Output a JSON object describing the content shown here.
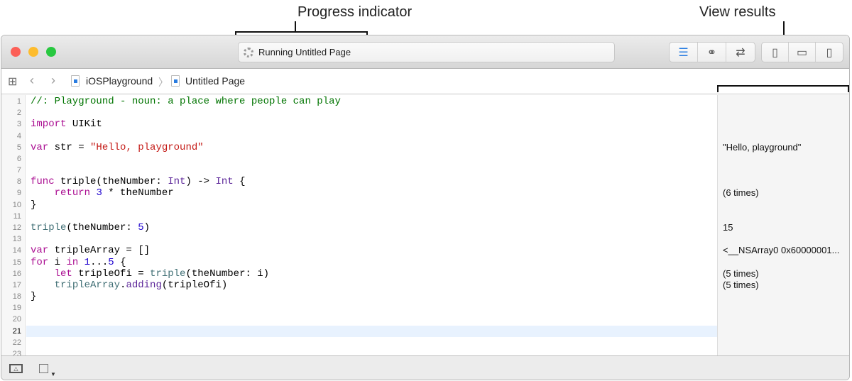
{
  "annotations": {
    "progress": "Progress indicator",
    "view_results": "View results"
  },
  "toolbar": {
    "status_text": "Running Untitled Page"
  },
  "breadcrumb": {
    "project": "iOSPlayground",
    "page": "Untitled Page"
  },
  "editor": {
    "current_line": 21,
    "line_numbers": [
      "1",
      "2",
      "3",
      "4",
      "5",
      "6",
      "7",
      "8",
      "9",
      "10",
      "11",
      "12",
      "13",
      "14",
      "15",
      "16",
      "17",
      "18",
      "19",
      "20",
      "21",
      "22",
      "23"
    ],
    "lines": [
      [
        [
          "//: Playground - noun: a place where people can play",
          "c"
        ]
      ],
      [],
      [
        [
          "import",
          "k"
        ],
        [
          " UIKit",
          "p"
        ]
      ],
      [],
      [
        [
          "var",
          "k"
        ],
        [
          " str = ",
          "p"
        ],
        [
          "\"Hello, playground\"",
          "s"
        ]
      ],
      [],
      [],
      [
        [
          "func",
          "k"
        ],
        [
          " triple(theNumber: ",
          "p"
        ],
        [
          "Int",
          "t"
        ],
        [
          ") -> ",
          "p"
        ],
        [
          "Int",
          "t"
        ],
        [
          " {",
          "p"
        ]
      ],
      [
        [
          "    ",
          "p"
        ],
        [
          "return",
          "k"
        ],
        [
          " ",
          "p"
        ],
        [
          "3",
          "n"
        ],
        [
          " * theNumber",
          "p"
        ]
      ],
      [
        [
          "}",
          "p"
        ]
      ],
      [],
      [
        [
          "triple",
          "f"
        ],
        [
          "(theNumber: ",
          "p"
        ],
        [
          "5",
          "n"
        ],
        [
          ")",
          "p"
        ]
      ],
      [],
      [
        [
          "var",
          "k"
        ],
        [
          " tripleArray = []",
          "p"
        ]
      ],
      [
        [
          "for",
          "k"
        ],
        [
          " i ",
          "p"
        ],
        [
          "in",
          "k"
        ],
        [
          " ",
          "p"
        ],
        [
          "1",
          "n"
        ],
        [
          "...",
          "p"
        ],
        [
          "5",
          "n"
        ],
        [
          " {",
          "p"
        ]
      ],
      [
        [
          "    ",
          "p"
        ],
        [
          "let",
          "k"
        ],
        [
          " tripleOfi = ",
          "p"
        ],
        [
          "triple",
          "f"
        ],
        [
          "(theNumber: i)",
          "p"
        ]
      ],
      [
        [
          "    ",
          "p"
        ],
        [
          "tripleArray",
          "f"
        ],
        [
          ".",
          "p"
        ],
        [
          "adding",
          "m"
        ],
        [
          "(tripleOfi)",
          "p"
        ]
      ],
      [
        [
          "}",
          "p"
        ]
      ],
      [],
      [],
      [],
      [],
      []
    ]
  },
  "results": [
    {
      "line": 5,
      "text": "\"Hello, playground\""
    },
    {
      "line": 9,
      "text": "(6 times)"
    },
    {
      "line": 12,
      "text": "15"
    },
    {
      "line": 14,
      "text": "<__NSArray0 0x60000001..."
    },
    {
      "line": 16,
      "text": "(5 times)"
    },
    {
      "line": 17,
      "text": "(5 times)"
    }
  ],
  "colors": {
    "close": "#fc5f57",
    "minimize": "#fdbc2e",
    "zoom": "#28c840",
    "accent": "#2a7de1"
  }
}
